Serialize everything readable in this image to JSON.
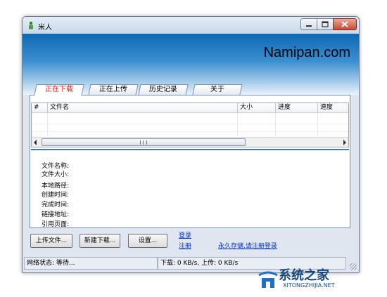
{
  "window": {
    "title": "米人",
    "brand": "Namipan.com"
  },
  "tabs": [
    {
      "label": "正在下载",
      "active": true
    },
    {
      "label": "正在上传",
      "active": false
    },
    {
      "label": "历史记录",
      "active": false
    },
    {
      "label": "关于",
      "active": false
    }
  ],
  "download_list": {
    "columns": [
      "#",
      "文件名",
      "大小",
      "进度",
      "速度"
    ],
    "rows": []
  },
  "details": {
    "labels": [
      "文件名称:",
      "文件大小:",
      "本地路径:",
      "创建时间:",
      "完成时间:",
      "链接地址:",
      "引用页面:"
    ]
  },
  "buttons": {
    "upload": "上传文件...",
    "new_download": "新建下载...",
    "settings": "设置..."
  },
  "links": {
    "login": "登录",
    "register": "注册",
    "permanent": "永久存储,请注册登录"
  },
  "status": {
    "network": "网络状态: 等待...",
    "speed": "下载: 0 KB/s, 上传: 0 KB/s"
  },
  "watermark": {
    "title": "系统之家",
    "url": "XITONGZHIJIA.NET"
  },
  "colors": {
    "accent_blue": "#0e68b3",
    "active_tab_text": "#d8241c",
    "link": "#0a37c8"
  }
}
